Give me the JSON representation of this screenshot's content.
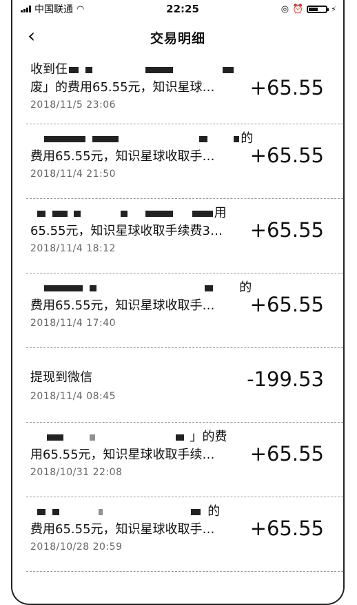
{
  "status_bar": {
    "carrier": "中国联通",
    "time": "22:25",
    "battery_level": 0.6
  },
  "header": {
    "back_icon": "chevron-left-icon",
    "title": "交易明细"
  },
  "transactions": [
    {
      "line1": "收到仼",
      "line2": "废」的费用65.55元，知识星球…",
      "date": "2018/11/5 23:06",
      "amount": "+65.55"
    },
    {
      "line1": "的",
      "line2": "费用65.55元，知识星球收取手…",
      "date": "2018/11/4 21:50",
      "amount": "+65.55"
    },
    {
      "line1": "用",
      "line2": "65.55元，知识星球收取手续费3…",
      "date": "2018/11/4 18:12",
      "amount": "+65.55"
    },
    {
      "line1": "的",
      "line2": "费用65.55元，知识星球收取手…",
      "date": "2018/11/4 17:40",
      "amount": "+65.55"
    },
    {
      "line1": "提现到微信",
      "line2": "",
      "date": "2018/11/4 08:45",
      "amount": "-199.53"
    },
    {
      "line1": "」的费",
      "line2": "用65.55元，知识星球收取手续…",
      "date": "2018/10/31 22:08",
      "amount": "+65.55"
    },
    {
      "line1": "的",
      "line2": "费用65.55元，知识星球收取手…",
      "date": "2018/10/28 20:59",
      "amount": "+65.55"
    }
  ]
}
